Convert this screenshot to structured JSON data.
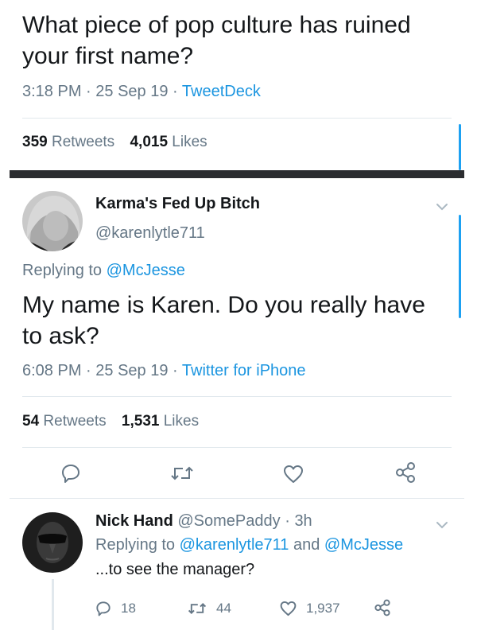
{
  "tweet1": {
    "text": "What piece of pop culture has ruined your first name?",
    "time": "3:18 PM",
    "date": "25 Sep 19",
    "source": "TweetDeck",
    "retweets_count": "359",
    "retweets_label": "Retweets",
    "likes_count": "4,015",
    "likes_label": "Likes"
  },
  "tweet2": {
    "display_name": "Karma's Fed Up Bitch",
    "handle": "@karenlytle711",
    "replying_prefix": "Replying to",
    "replying_to": "@McJesse",
    "text": "My name is Karen. Do you really have to ask?",
    "time": "6:08 PM",
    "date": "25 Sep 19",
    "source": "Twitter for iPhone",
    "retweets_count": "54",
    "retweets_label": "Retweets",
    "likes_count": "1,531",
    "likes_label": "Likes"
  },
  "tweet3": {
    "display_name": "Nick Hand",
    "handle": "@SomePaddy",
    "age": "3h",
    "replying_prefix": "Replying to",
    "replying_to_1": "@karenlytle711",
    "and_word": "and",
    "replying_to_2": "@McJesse",
    "text": "...to see the manager?",
    "replies_count": "18",
    "retweets_count": "44",
    "likes_count": "1,937"
  },
  "separator": "·",
  "colors": {
    "link": "#1b95e0",
    "muted": "#657786",
    "text": "#14171a",
    "divider": "#e1e8ed",
    "accent": "#1da1f2"
  },
  "icons": [
    "reply-icon",
    "retweet-icon",
    "like-icon",
    "share-icon",
    "chevron-down-icon"
  ]
}
